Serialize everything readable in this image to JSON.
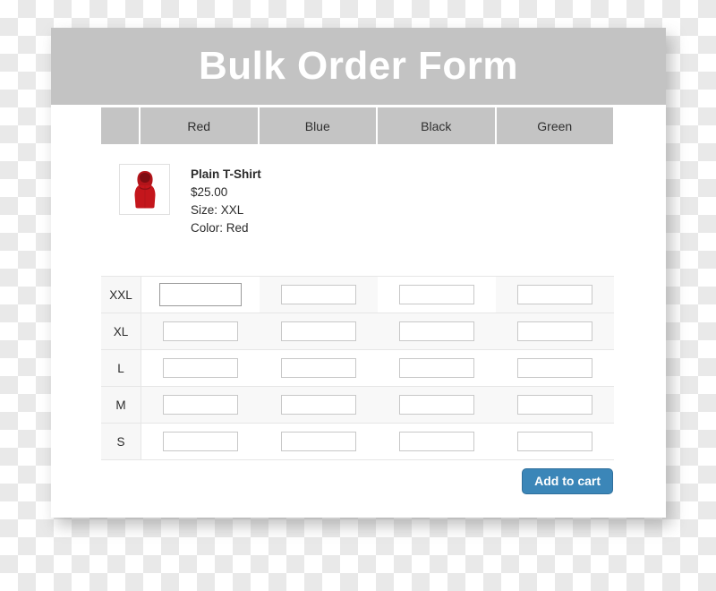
{
  "window": {
    "title": "Bulk Order Form"
  },
  "table": {
    "blank_header": "",
    "color_columns": [
      "Red",
      "Blue",
      "Black",
      "Green"
    ],
    "size_rows": [
      "XXL",
      "XL",
      "L",
      "M",
      "S"
    ],
    "quantity_placeholder": "",
    "quantities": [
      [
        "",
        "",
        "",
        ""
      ],
      [
        "",
        "",
        "",
        ""
      ],
      [
        "",
        "",
        "",
        ""
      ],
      [
        "",
        "",
        "",
        ""
      ],
      [
        "",
        "",
        "",
        ""
      ]
    ],
    "focused_cell": {
      "row": "XXL",
      "column": "Red"
    }
  },
  "product": {
    "thumbnail_icon": "red-hooded-shirt-icon",
    "name": "Plain T-Shirt",
    "price": "$25.00",
    "size": "Size: XXL",
    "color": "Color: Red"
  },
  "footer": {
    "add_to_cart_label": "Add to cart"
  },
  "colors": {
    "header_bar": "#c3c3c3",
    "table_header_cell": "#c4c4c4",
    "button_blue": "#3b86b8",
    "garment_red": "#c4161c",
    "text": "#2b2b2b"
  }
}
